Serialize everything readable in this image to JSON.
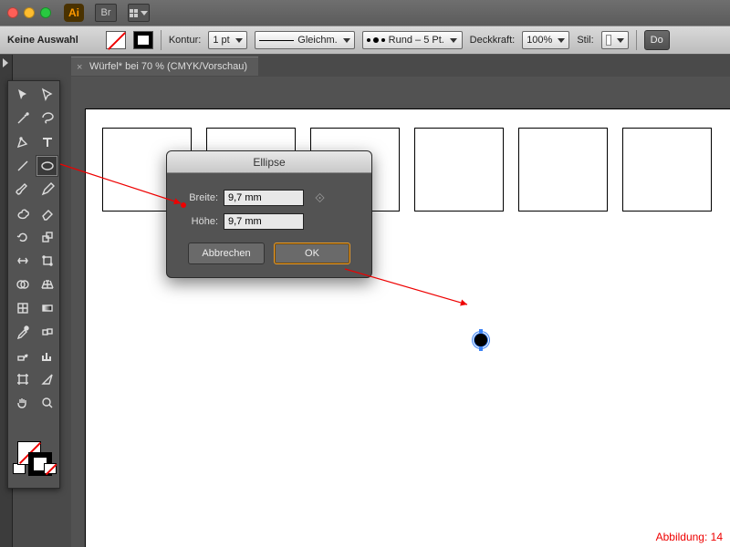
{
  "app": {
    "short": "Ai",
    "bridge": "Br"
  },
  "controlbar": {
    "selection": "Keine Auswahl",
    "kontur_label": "Kontur:",
    "stroke_weight": "1 pt",
    "dash_label": "Gleichm.",
    "profile_label": "Rund – 5 Pt.",
    "opacity_label": "Deckkraft:",
    "opacity_value": "100%",
    "style_label": "Stil:",
    "doc_btn": "Do"
  },
  "doc_tab": {
    "title": "Würfel* bei 70 % (CMYK/Vorschau)"
  },
  "dialog": {
    "title": "Ellipse",
    "width_label": "Breite:",
    "width_value": "9,7 mm",
    "height_label": "Höhe:",
    "height_value": "9,7 mm",
    "cancel": "Abbrechen",
    "ok": "OK"
  },
  "caption": "Abbildung: 14"
}
